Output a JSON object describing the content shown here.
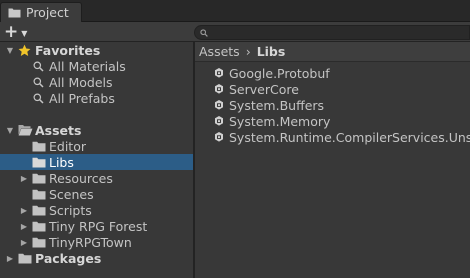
{
  "tab": {
    "title": "Project"
  },
  "toolbar": {
    "add_label": "+",
    "search": {
      "value": "",
      "placeholder": ""
    }
  },
  "tree": {
    "favorites": {
      "label": "Favorites",
      "items": [
        "All Materials",
        "All Models",
        "All Prefabs"
      ]
    },
    "assets": {
      "label": "Assets",
      "children": [
        {
          "label": "Editor",
          "has_children": false,
          "selected": false
        },
        {
          "label": "Libs",
          "has_children": false,
          "selected": true
        },
        {
          "label": "Resources",
          "has_children": true,
          "selected": false
        },
        {
          "label": "Scenes",
          "has_children": false,
          "selected": false
        },
        {
          "label": "Scripts",
          "has_children": true,
          "selected": false
        },
        {
          "label": "Tiny RPG Forest",
          "has_children": true,
          "selected": false
        },
        {
          "label": "TinyRPGTown",
          "has_children": true,
          "selected": false
        }
      ]
    },
    "packages": {
      "label": "Packages"
    }
  },
  "breadcrumb": {
    "root": "Assets",
    "current": "Libs"
  },
  "files": [
    "Google.Protobuf",
    "ServerCore",
    "System.Buffers",
    "System.Memory",
    "System.Runtime.CompilerServices.Unsafe"
  ],
  "colors": {
    "background": "#383838",
    "selection": "#2c5d87",
    "folder": "#c2c2c2",
    "star": "#f0c42a"
  }
}
